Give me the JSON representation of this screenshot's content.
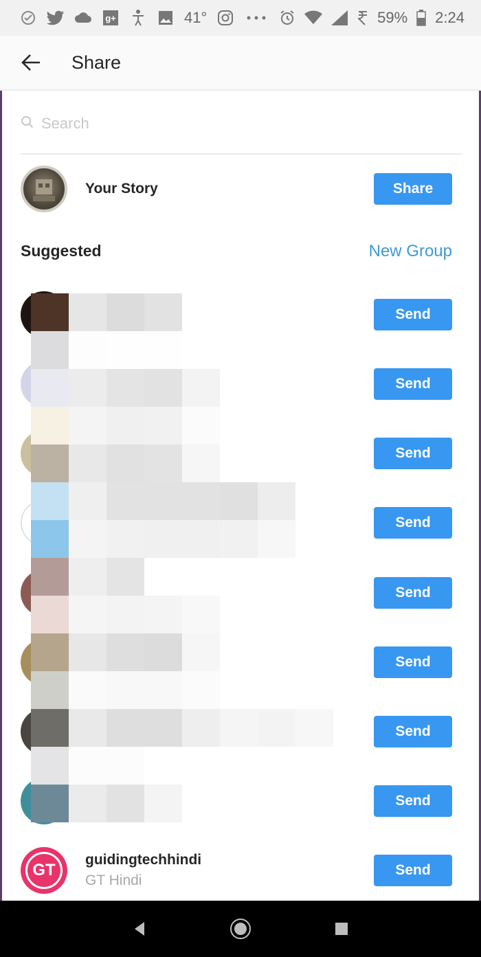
{
  "status_bar": {
    "temperature": "41°",
    "battery": "59%",
    "time": "2:24",
    "icons_left": [
      "check-circle-icon",
      "twitter-icon",
      "cloud-icon",
      "google-plus-icon",
      "accessibility-icon",
      "image-icon",
      "instagram-icon",
      "more-icon"
    ],
    "icons_right": [
      "alarm-icon",
      "wifi-icon",
      "signal-icon",
      "rupee-icon",
      "battery-icon"
    ]
  },
  "header": {
    "title": "Share"
  },
  "search": {
    "placeholder": "Search"
  },
  "your_story": {
    "label": "Your Story",
    "button": "Share"
  },
  "suggested": {
    "section_label": "Suggested",
    "new_group_label": "New Group",
    "send_label": "Send",
    "rows": [
      {
        "name": "",
        "sub": ""
      },
      {
        "name": "",
        "sub": ""
      },
      {
        "name": "",
        "sub": ""
      },
      {
        "name": "",
        "sub": ""
      },
      {
        "name": "",
        "sub": ""
      },
      {
        "name": "",
        "sub": ""
      },
      {
        "name": "",
        "sub": ""
      },
      {
        "name": "",
        "sub": ""
      },
      {
        "name": "guidingtechhindi",
        "sub": "GT Hindi"
      }
    ]
  },
  "gt_avatar_text": "GT",
  "colors": {
    "accent": "#3897f0",
    "link": "#3c9ad8",
    "gt_avatar": "#e8336b"
  }
}
